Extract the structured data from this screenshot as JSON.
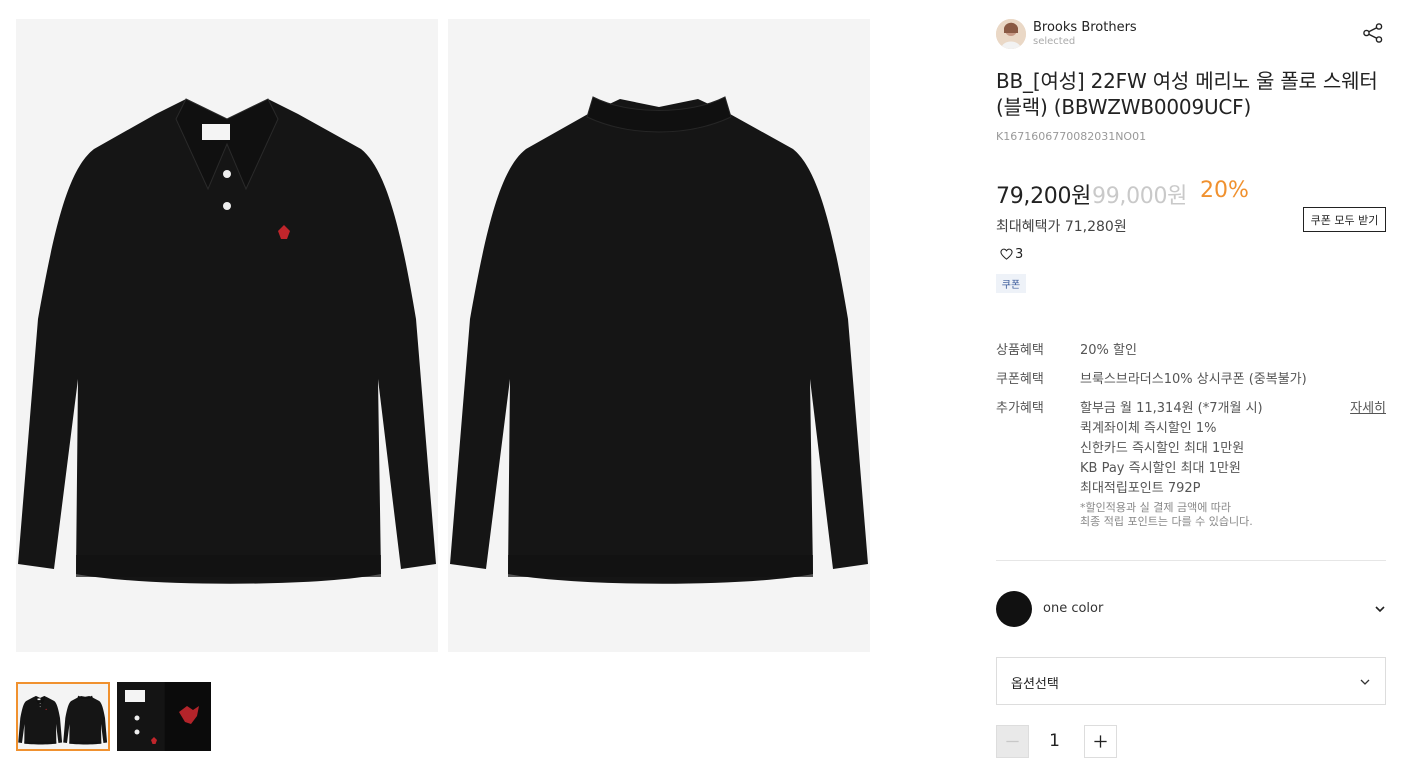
{
  "gallery": {
    "main_images": [
      {
        "name": "product-front-image",
        "view": "front"
      },
      {
        "name": "product-back-image",
        "view": "back"
      }
    ],
    "thumbnails": [
      {
        "name": "thumbnail-front-back",
        "selected": true
      },
      {
        "name": "thumbnail-detail",
        "selected": false
      }
    ]
  },
  "brand": {
    "name": "Brooks Brothers",
    "sub": "selected"
  },
  "product": {
    "title": "BB_[여성] 22FW 여성 메리노 울 폴로 스웨터 (블랙) (BBWZWB0009UCF)",
    "code": "K1671606770082031NO01",
    "price_sale": "79,200원",
    "price_original": "99,000원",
    "discount_rate": "20%",
    "max_benefit": "최대혜택가 71,280원",
    "coupon_all_label": "쿠폰 모두 받기",
    "like_count": "3",
    "coupon_tag": "쿠폰"
  },
  "benefits": {
    "product_label": "상품혜택",
    "product_value": "20% 할인",
    "coupon_label": "쿠폰혜택",
    "coupon_value": "브룩스브라더스10% 상시쿠폰 (중복불가)",
    "extra_label": "추가혜택",
    "extra_lines": [
      "할부금 월 11,314원 (*7개월 시)",
      "퀵계좌이체 즉시할인 1%",
      "신한카드 즉시할인 최대 1만원",
      "KB Pay 즉시할인 최대 1만원",
      "최대적립포인트 792P"
    ],
    "note_lines": [
      "*할인적용과 실 결제 금액에 따라",
      "최종 적립 포인트는 다를 수 있습니다."
    ],
    "detail_link": "자세히"
  },
  "color": {
    "name": "one color",
    "swatch": "#111111"
  },
  "option": {
    "label": "옵션선택"
  },
  "quantity": {
    "value": "1"
  },
  "colors": {
    "accent": "#f0912f",
    "sale_text": "#222222",
    "original_price": "#c9c9c9",
    "coupon_tag_bg": "#eef2f8"
  }
}
